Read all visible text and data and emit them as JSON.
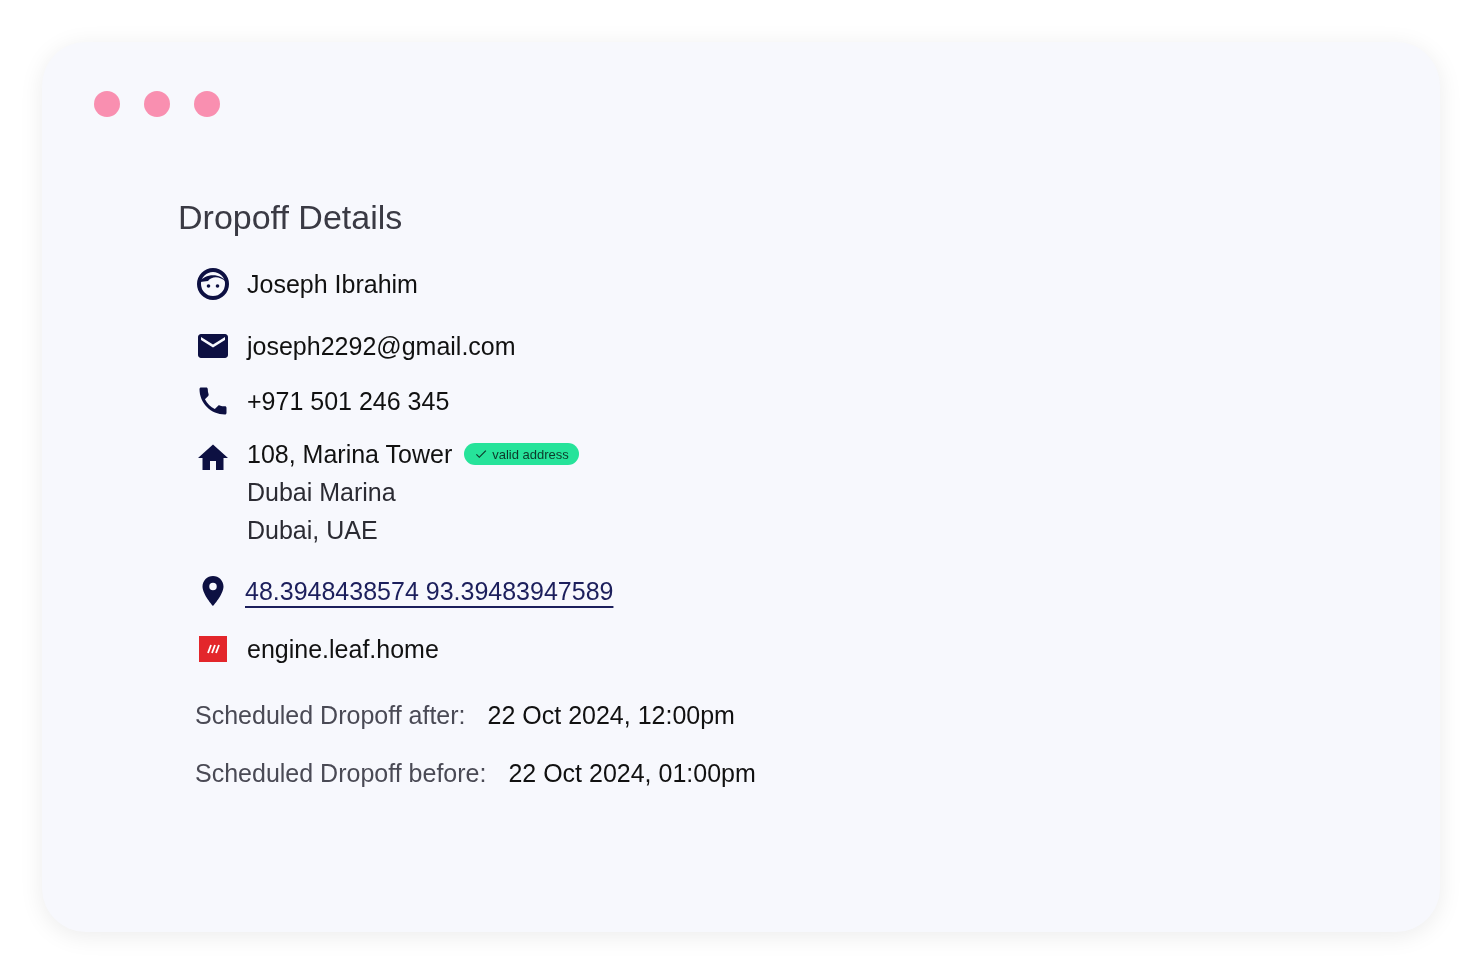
{
  "title": "Dropoff Details",
  "contacts": [
    {
      "kind": "person",
      "text": "Joseph Ibrahim"
    },
    {
      "kind": "email",
      "text": "joseph2292@gmail.com"
    },
    {
      "kind": "phone",
      "text": "+971 501 246 345"
    },
    {
      "kind": "address",
      "lines": [
        "108, Marina Tower",
        "Dubai Marina",
        "Dubai, UAE"
      ],
      "badge": "valid address"
    },
    {
      "kind": "location",
      "link": "48.3948438574 93.39483947589"
    },
    {
      "kind": "engine",
      "text": "engine.leaf.home"
    }
  ],
  "schedule": [
    {
      "label": "Scheduled Dropoff after:",
      "value": "22 Oct 2024, 12:00pm"
    },
    {
      "label": "Scheduled Dropoff before:",
      "value": "22 Oct 2024, 01:00pm"
    }
  ]
}
